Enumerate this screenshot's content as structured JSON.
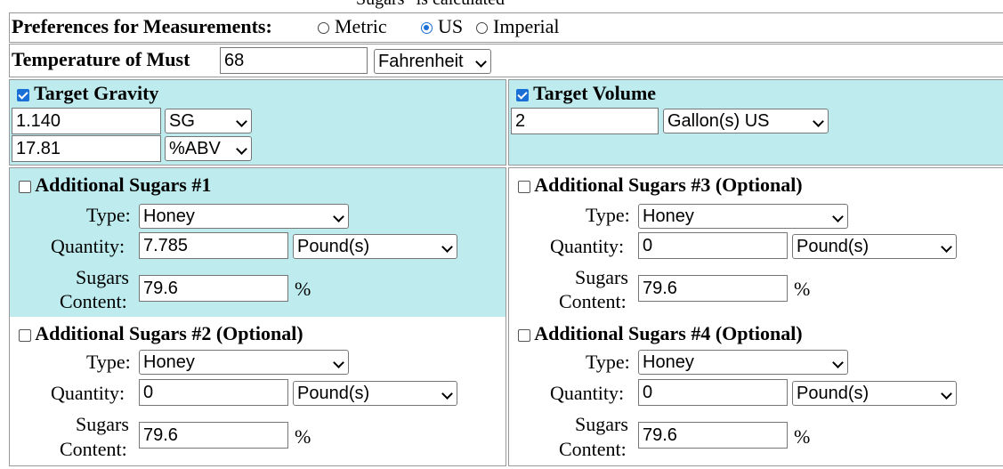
{
  "top_fragment": "Sugars\" is calculated",
  "preferences": {
    "label": "Preferences for Measurements:",
    "options": [
      "Metric",
      "US",
      "Imperial"
    ],
    "selected": "US"
  },
  "temperature": {
    "label": "Temperature of Must",
    "value": "68",
    "unit": "Fahrenheit"
  },
  "target_gravity": {
    "label": "Target Gravity",
    "checked": true,
    "gravity_value": "1.140",
    "gravity_unit": "SG",
    "abv_value": "17.81",
    "abv_unit": "%ABV"
  },
  "target_volume": {
    "label": "Target Volume",
    "checked": true,
    "value": "2",
    "unit": "Gallon(s) US"
  },
  "field_labels": {
    "type": "Type:",
    "quantity": "Quantity:",
    "sugars": "Sugars",
    "content": "Content:",
    "percent": "%"
  },
  "sugars": [
    {
      "title": "Additional Sugars #1",
      "type": "Honey",
      "quantity": "7.785",
      "unit": "Pound(s)",
      "content": "79.6"
    },
    {
      "title": "Additional Sugars #2 (Optional)",
      "type": "Honey",
      "quantity": "0",
      "unit": "Pound(s)",
      "content": "79.6"
    },
    {
      "title": "Additional Sugars #3 (Optional)",
      "type": "Honey",
      "quantity": "0",
      "unit": "Pound(s)",
      "content": "79.6"
    },
    {
      "title": "Additional Sugars #4 (Optional)",
      "type": "Honey",
      "quantity": "0",
      "unit": "Pound(s)",
      "content": "79.6"
    }
  ],
  "colors": {
    "highlight": "#bdebee",
    "accent": "#1a6fd6"
  }
}
